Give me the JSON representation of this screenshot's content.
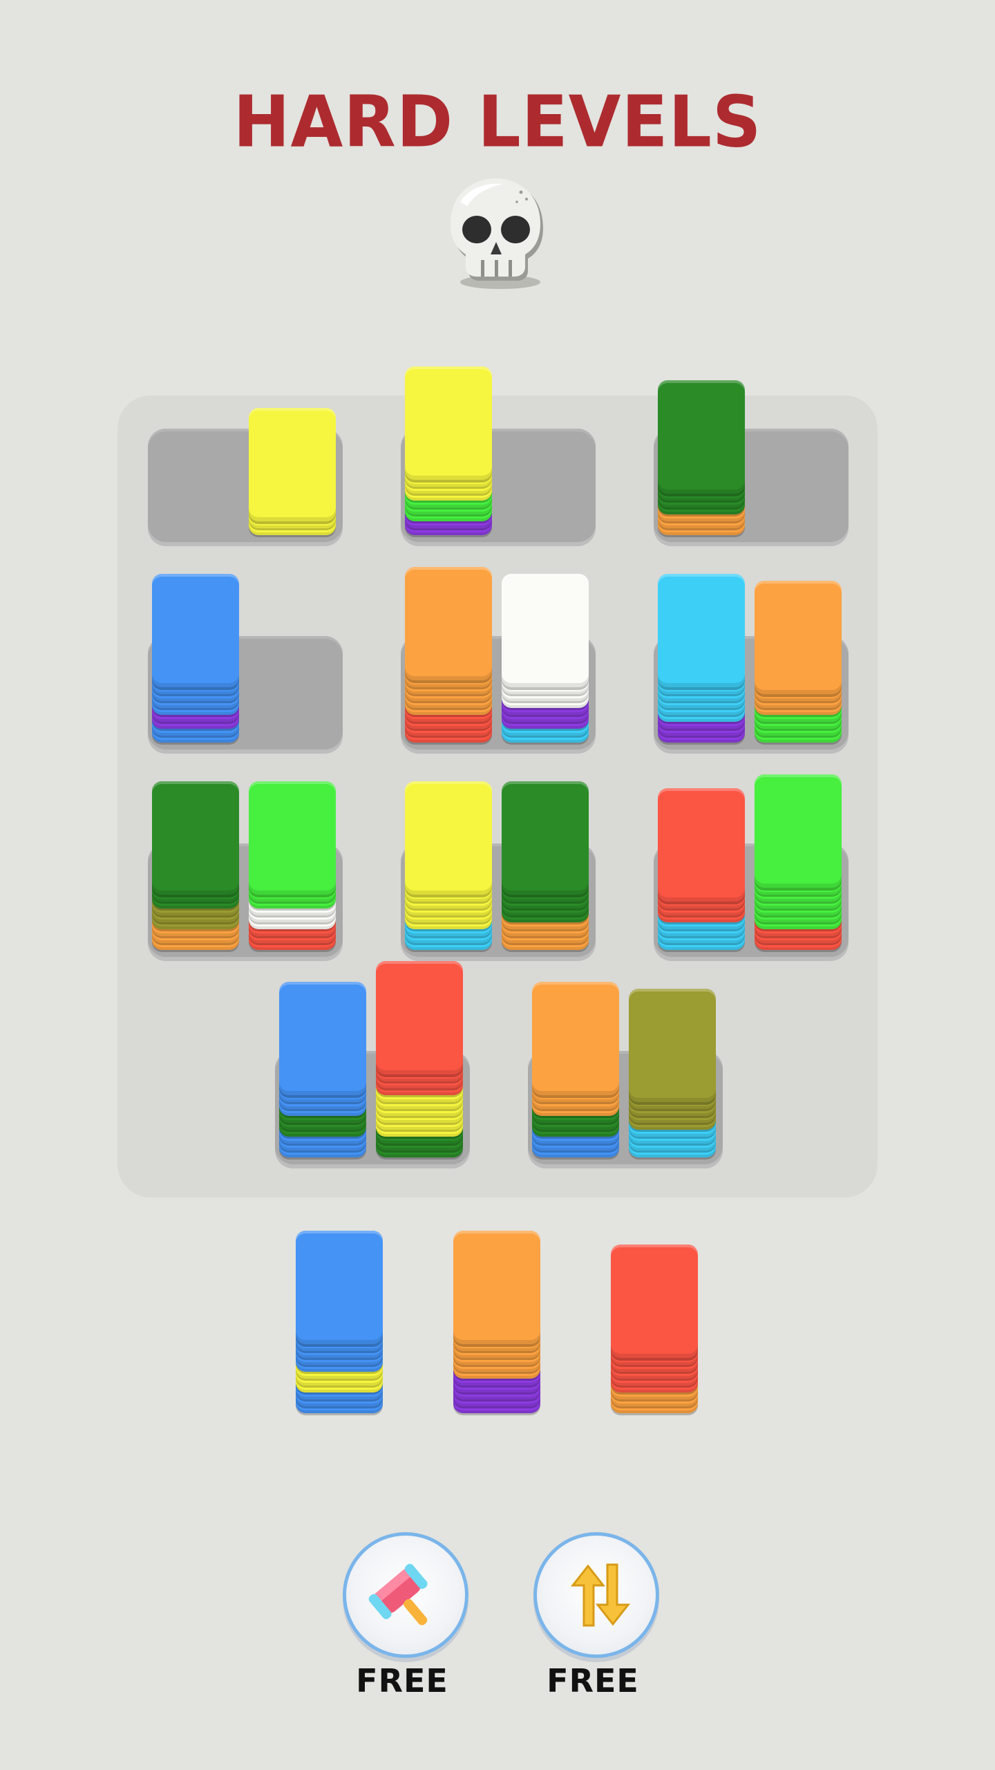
{
  "header": {
    "title": "HARD LEVELS",
    "badge_icon": "skull-icon"
  },
  "colors": {
    "yellow": "#f6f640",
    "green": "#47ef3f",
    "dkgreen": "#2a8b27",
    "purple": "#8c3be0",
    "orange": "#fca241",
    "blue": "#4493f5",
    "white": "#fbfbf8",
    "red": "#fb5544",
    "cyan": "#3ecff7",
    "olive": "#9b9c32",
    "tray": "#a9a9a9",
    "title": "#ad2b2f"
  },
  "board": {
    "rows": [
      [
        {
          "stacks": [
            [],
            [
              "yellow",
              "yellow",
              "yellow"
            ]
          ]
        },
        {
          "stacks": [
            [
              "purple",
              "purple",
              "green",
              "green",
              "green",
              "yellow",
              "yellow",
              "yellow",
              "yellow"
            ],
            []
          ]
        },
        {
          "stacks": [
            [
              "orange",
              "orange",
              "orange",
              "dkgreen",
              "dkgreen",
              "dkgreen",
              "dkgreen"
            ],
            []
          ]
        }
      ],
      [
        {
          "stacks": [
            [
              "blue",
              "blue",
              "purple",
              "purple",
              "blue",
              "blue",
              "blue",
              "blue",
              "blue"
            ],
            []
          ],
          "tray": false
        },
        {
          "stacks": [
            [
              "red",
              "red",
              "red",
              "red",
              "orange",
              "orange",
              "orange",
              "orange",
              "orange",
              "orange"
            ],
            [
              "cyan",
              "cyan",
              "purple",
              "purple",
              "purple",
              "white",
              "white",
              "white",
              "white"
            ]
          ]
        },
        {
          "stacks": [
            [
              "purple",
              "purple",
              "purple",
              "cyan",
              "cyan",
              "cyan",
              "cyan",
              "cyan",
              "cyan"
            ],
            [
              "green",
              "green",
              "green",
              "green",
              "orange",
              "orange",
              "orange",
              "orange"
            ]
          ]
        }
      ],
      [
        {
          "stacks": [
            [
              "orange",
              "orange",
              "orange",
              "olive",
              "olive",
              "olive",
              "dkgreen",
              "dkgreen",
              "dkgreen"
            ],
            [
              "red",
              "red",
              "red",
              "white",
              "white",
              "white",
              "green",
              "green",
              "green"
            ]
          ]
        },
        {
          "stacks": [
            [
              "cyan",
              "cyan",
              "cyan",
              "yellow",
              "yellow",
              "yellow",
              "yellow",
              "yellow",
              "yellow"
            ],
            [
              "orange",
              "orange",
              "orange",
              "orange",
              "dkgreen",
              "dkgreen",
              "dkgreen",
              "dkgreen",
              "dkgreen"
            ]
          ]
        },
        {
          "stacks": [
            [
              "cyan",
              "cyan",
              "cyan",
              "cyan",
              "red",
              "red",
              "red",
              "red"
            ],
            [
              "red",
              "red",
              "red",
              "green",
              "green",
              "green",
              "green",
              "green",
              "green",
              "green"
            ]
          ]
        }
      ],
      [
        {
          "stacks": [
            [
              "blue",
              "blue",
              "blue",
              "dkgreen",
              "dkgreen",
              "dkgreen",
              "blue",
              "blue",
              "blue",
              "blue"
            ],
            [
              "dkgreen",
              "dkgreen",
              "dkgreen",
              "yellow",
              "yellow",
              "yellow",
              "yellow",
              "yellow",
              "yellow",
              "red",
              "red",
              "red",
              "red"
            ]
          ]
        },
        {
          "stacks": [
            [
              "blue",
              "blue",
              "blue",
              "dkgreen",
              "dkgreen",
              "dkgreen",
              "orange",
              "orange",
              "orange",
              "orange"
            ],
            [
              "cyan",
              "cyan",
              "cyan",
              "cyan",
              "olive",
              "olive",
              "olive",
              "olive",
              "olive"
            ]
          ]
        }
      ]
    ]
  },
  "queue": [
    [
      "blue",
      "blue",
      "blue",
      "yellow",
      "yellow",
      "yellow",
      "blue",
      "blue",
      "blue",
      "blue",
      "blue"
    ],
    [
      "purple",
      "purple",
      "purple",
      "purple",
      "purple",
      "orange",
      "orange",
      "orange",
      "orange",
      "orange",
      "orange"
    ],
    [
      "orange",
      "orange",
      "orange",
      "red",
      "red",
      "red",
      "red",
      "red",
      "red"
    ]
  ],
  "boosters": [
    {
      "icon": "hammer-icon",
      "label": "FREE"
    },
    {
      "icon": "swap-arrows-icon",
      "label": "FREE"
    }
  ]
}
